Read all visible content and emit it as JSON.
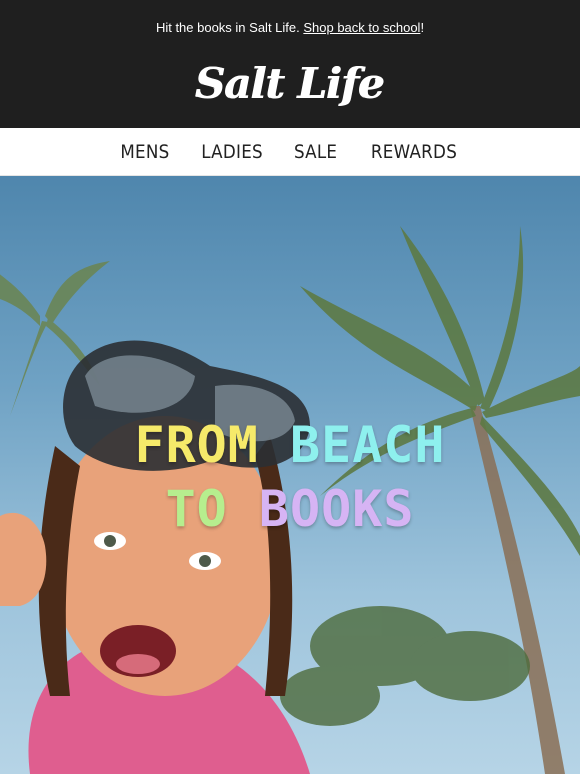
{
  "header": {
    "promo_text": "Hit the books in Salt Life. ",
    "promo_link": "Shop back to school",
    "promo_end": "!",
    "logo_text": "Salt Life"
  },
  "nav": {
    "items": [
      {
        "label": "MENS"
      },
      {
        "label": "LADIES"
      },
      {
        "label": "SALE"
      },
      {
        "label": "REWARDS"
      }
    ]
  },
  "hero": {
    "line1_word1": "FROM",
    "line1_word2": "BEACH",
    "line2_word1": "TO",
    "line2_word2": "BOOKS",
    "image": "child-with-snorkel-mask-under-palm-trees"
  },
  "colors": {
    "header_bg": "#1f1f1f",
    "from": "#f6ea6a",
    "beach": "#8ef0ee",
    "to": "#b6ee8e",
    "books": "#d6b4f4"
  }
}
